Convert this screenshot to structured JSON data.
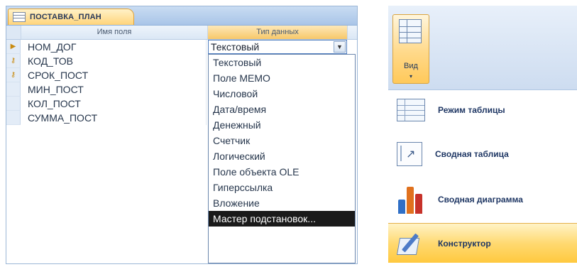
{
  "designer": {
    "tab_title": "ПОСТАВКА_ПЛАН",
    "col_field_name": "Имя поля",
    "col_data_type": "Тип данных",
    "fields": [
      "НОМ_ДОГ",
      "КОД_ТОВ",
      "СРОК_ПОСТ",
      "МИН_ПОСТ",
      "КОЛ_ПОСТ",
      "СУММА_ПОСТ"
    ],
    "current_type": "Текстовый",
    "type_options": [
      "Текстовый",
      "Поле MEMO",
      "Числовой",
      "Дата/время",
      "Денежный",
      "Счетчик",
      "Логический",
      "Поле объекта OLE",
      "Гиперссылка",
      "Вложение",
      "Мастер подстановок..."
    ],
    "selected_option": "Мастер подстановок..."
  },
  "ribbon": {
    "view_label": "Вид",
    "view_arrow": "▾",
    "items": [
      {
        "label": "Режим таблицы",
        "icon": "datasheet-icon"
      },
      {
        "label": "Сводная таблица",
        "icon": "pivot-table-icon"
      },
      {
        "label": "Сводная диаграмма",
        "icon": "pivot-chart-icon"
      },
      {
        "label": "Конструктор",
        "icon": "design-view-icon",
        "active": true
      }
    ]
  },
  "colors": {
    "accent_orange": "#ffd470",
    "ribbon_blue": "#cddcf0",
    "selected_item": "#1a1a1a"
  }
}
